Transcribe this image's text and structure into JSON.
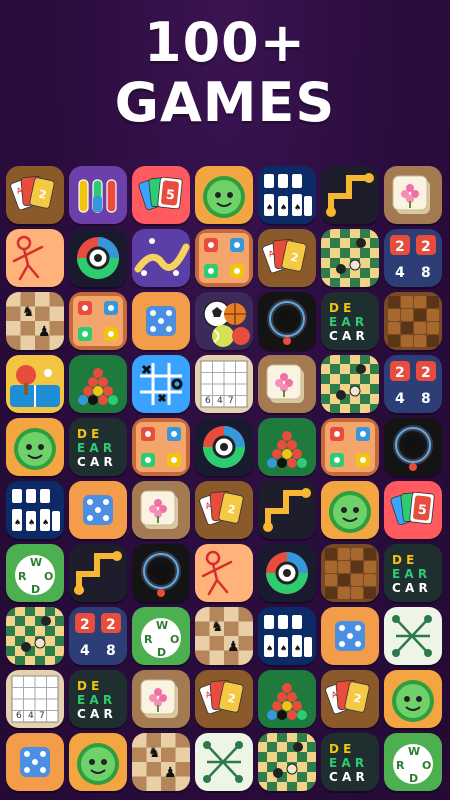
{
  "promo": {
    "line1": "100+",
    "line2": "GAMES"
  },
  "icons": [
    [
      "solitaire-cards",
      "water-sort",
      "uno-cards",
      "watermelon",
      "klondike",
      "connect-dots",
      "mahjong"
    ],
    [
      "stickman",
      "slither",
      "snake",
      "ludo-board",
      "solitaire-cards",
      "checkers",
      "2248"
    ],
    [
      "chess",
      "ludo-board",
      "dice",
      "sports-balls",
      "dark-ring",
      "word-search",
      "wood-block"
    ],
    [
      "ping-pong",
      "snooker",
      "tic-tac-toe",
      "sudoku",
      "mahjong",
      "checkers",
      "2248"
    ],
    [
      "watermelon",
      "word-search",
      "ludo-board",
      "slither",
      "snooker",
      "ludo-board",
      "dark-ring"
    ],
    [
      "klondike",
      "dice",
      "mahjong",
      "solitaire-cards",
      "connect-dots",
      "watermelon",
      "uno-cards"
    ],
    [
      "word-connect",
      "connect-dots",
      "dark-ring",
      "stickman",
      "slither",
      "wood-block",
      "word-search"
    ],
    [
      "checkers",
      "2248",
      "word-connect",
      "chess",
      "klondike",
      "dice",
      "line-connect"
    ],
    [
      "sudoku",
      "word-search",
      "mahjong",
      "solitaire-cards",
      "snooker",
      "solitaire-cards",
      "watermelon"
    ],
    [
      "dice",
      "watermelon",
      "chess",
      "line-connect",
      "checkers",
      "word-search",
      "word-connect"
    ]
  ]
}
